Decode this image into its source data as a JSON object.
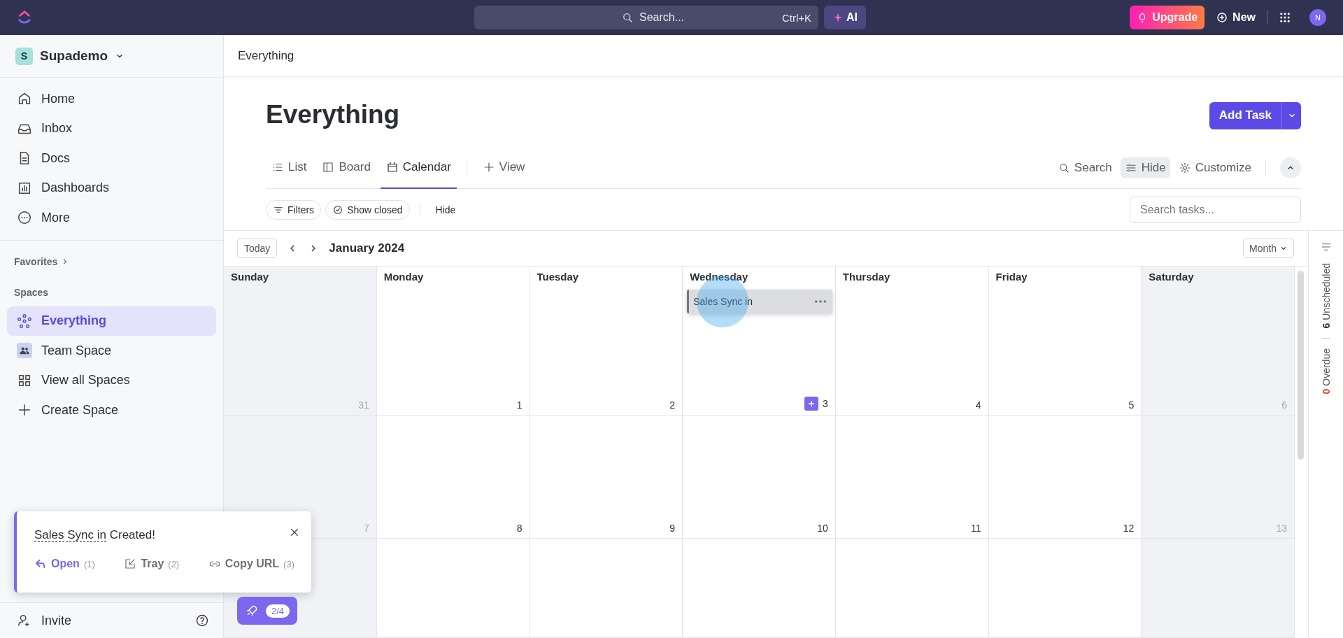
{
  "topbar": {
    "search_placeholder": "Search...",
    "shortcut": "Ctrl+K",
    "ai_label": "AI",
    "upgrade_label": "Upgrade",
    "new_label": "New",
    "avatar_initial": "N"
  },
  "sidebar": {
    "workspace": {
      "initial": "S",
      "name": "Supademo"
    },
    "nav": [
      {
        "label": "Home"
      },
      {
        "label": "Inbox"
      },
      {
        "label": "Docs"
      },
      {
        "label": "Dashboards"
      },
      {
        "label": "More"
      }
    ],
    "favorites_label": "Favorites",
    "spaces_label": "Spaces",
    "spaces": [
      {
        "label": "Everything",
        "selected": true
      },
      {
        "label": "Team Space",
        "selected": false
      },
      {
        "label": "View all Spaces",
        "selected": false
      },
      {
        "label": "Create Space",
        "selected": false
      }
    ],
    "invite_label": "Invite"
  },
  "breadcrumb": "Everything",
  "page_title": "Everything",
  "add_task_label": "Add Task",
  "views": [
    {
      "label": "List",
      "selected": false
    },
    {
      "label": "Board",
      "selected": false
    },
    {
      "label": "Calendar",
      "selected": true
    }
  ],
  "add_view_label": "View",
  "view_actions": [
    {
      "label": "Search",
      "selected": false
    },
    {
      "label": "Hide",
      "selected": true
    },
    {
      "label": "Customize",
      "selected": false
    }
  ],
  "filters": [
    {
      "label": "Filters"
    },
    {
      "label": "Show closed"
    }
  ],
  "hide_label": "Hide",
  "search_tasks_placeholder": "Search tasks...",
  "calendar": {
    "today_label": "Today",
    "month_label": "January 2024",
    "mode_label": "Month",
    "day_headers": [
      {
        "label": "Sunday",
        "weekend": true
      },
      {
        "label": "Monday",
        "weekend": false
      },
      {
        "label": "Tuesday",
        "weekend": false
      },
      {
        "label": "Wednesday",
        "weekend": false
      },
      {
        "label": "Thursday",
        "weekend": false
      },
      {
        "label": "Friday",
        "weekend": false
      },
      {
        "label": "Saturday",
        "weekend": true
      }
    ],
    "weeks": [
      {
        "days": [
          {
            "number": "31",
            "muted": true,
            "add_button": false
          },
          {
            "number": "1",
            "muted": false,
            "add_button": false
          },
          {
            "number": "2",
            "muted": false,
            "add_button": false
          },
          {
            "number": "3",
            "muted": false,
            "add_button": true,
            "events": [
              {
                "title": "Sales Sync in",
                "clicked": true
              }
            ]
          },
          {
            "number": "4",
            "muted": false,
            "add_button": false
          },
          {
            "number": "5",
            "muted": false,
            "add_button": false
          },
          {
            "number": "6",
            "muted": true,
            "add_button": false
          }
        ]
      },
      {
        "days": [
          {
            "number": "7",
            "muted": true,
            "add_button": false
          },
          {
            "number": "8",
            "muted": false,
            "add_button": false
          },
          {
            "number": "9",
            "muted": false,
            "add_button": false
          },
          {
            "number": "10",
            "muted": false,
            "add_button": false
          },
          {
            "number": "11",
            "muted": false,
            "add_button": false
          },
          {
            "number": "12",
            "muted": false,
            "add_button": false
          },
          {
            "number": "13",
            "muted": true,
            "add_button": false
          }
        ]
      }
    ],
    "side_counts": [
      {
        "count": "6",
        "label": "Unscheduled",
        "color": "#2a2e34"
      },
      {
        "count": "0",
        "label": "Overdue",
        "color": "#d33d2c"
      }
    ]
  },
  "toast": {
    "task_name": "Sales Sync in",
    "message": "Created!",
    "actions": [
      {
        "label": "Open",
        "shortcut": "(1)"
      },
      {
        "label": "Tray",
        "shortcut": "(2)"
      },
      {
        "label": "Copy URL",
        "shortcut": "(3)"
      }
    ]
  },
  "progress_badge": "2/4"
}
